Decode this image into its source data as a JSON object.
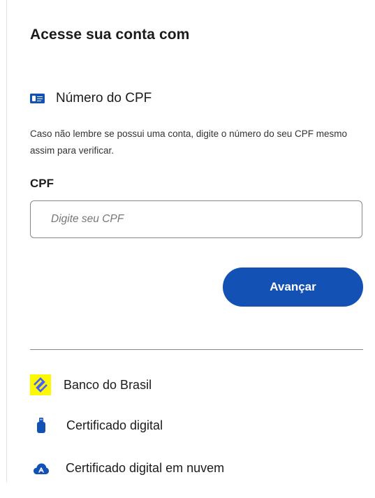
{
  "login": {
    "title": "Acesse sua conta com",
    "cpf_option": {
      "icon": "id-card-icon",
      "label": "Número do CPF"
    },
    "hint": "Caso não lembre se possui uma conta, digite o número do seu CPF mesmo assim para verificar.",
    "field_label": "CPF",
    "input": {
      "value": "",
      "placeholder": "Digite seu CPF"
    },
    "next_button": "Avançar",
    "other_methods": [
      {
        "icon": "banco-do-brasil-icon",
        "label": "Banco do Brasil"
      },
      {
        "icon": "usb-token-icon",
        "label": "Certificado digital"
      },
      {
        "icon": "cloud-certificate-icon",
        "label": "Certificado digital em nuvem"
      }
    ]
  },
  "colors": {
    "primary": "#1351b4",
    "text": "#1b1b1b",
    "bb_yellow": "#fcf800",
    "bb_blue": "#465eff"
  }
}
